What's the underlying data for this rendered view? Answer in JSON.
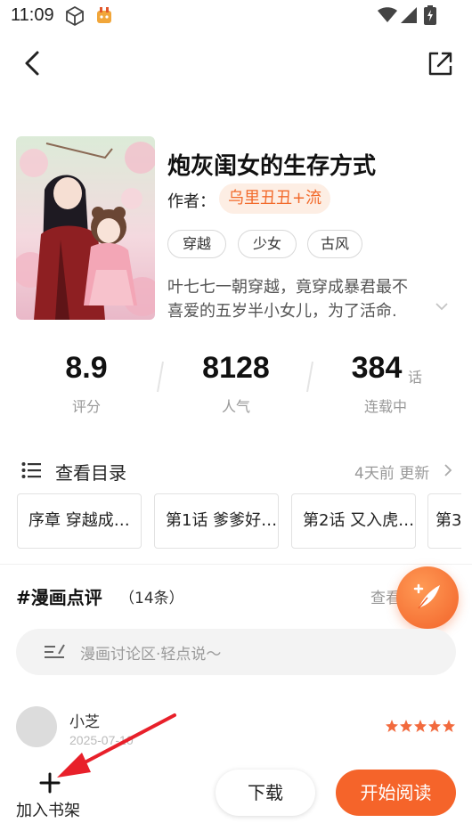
{
  "status_bar": {
    "time": "11:09",
    "icons": [
      "cube-icon",
      "app-notification-icon",
      "wifi-icon",
      "signal-icon",
      "battery-icon"
    ]
  },
  "nav": {
    "back_icon": "back-arrow-icon",
    "share_icon": "share-icon"
  },
  "comic": {
    "title": "炮灰闺女的生存方式",
    "author_label": "作者：",
    "author": "乌里丑丑+流",
    "tags": [
      "穿越",
      "少女",
      "古风"
    ],
    "synopsis_line1": "叶七七一朝穿越，竟穿成暴君最不",
    "synopsis_line2": "喜爱的五岁半小女儿，为了活命."
  },
  "stats": {
    "rating": {
      "value": "8.9",
      "label": "评分"
    },
    "popularity": {
      "value": "8128",
      "label": "人气"
    },
    "episodes": {
      "value": "384",
      "unit": "话",
      "label": "连载中"
    }
  },
  "catalog": {
    "title": "查看目录",
    "update": "4天前 更新",
    "chapters": [
      {
        "label": "序章 穿越成…"
      },
      {
        "label": "第1话 爹爹好…"
      },
      {
        "label": "第2话 又入虎…"
      },
      {
        "label": "第3"
      }
    ]
  },
  "reviews": {
    "title": "#漫画点评",
    "count": "（14条）",
    "more": "查看",
    "comment_placeholder": "漫画讨论区·轻点说～",
    "items": [
      {
        "user": "小芝",
        "date": "2025-07-10",
        "stars": 5
      }
    ]
  },
  "bottom_bar": {
    "bookshelf": "加入书架",
    "download": "下载",
    "read": "开始阅读"
  },
  "colors": {
    "accent": "#f5642a",
    "author_chip_bg": "#fdeee4",
    "author_chip_text": "#f26a2b",
    "annotation_arrow": "#e8202a"
  }
}
